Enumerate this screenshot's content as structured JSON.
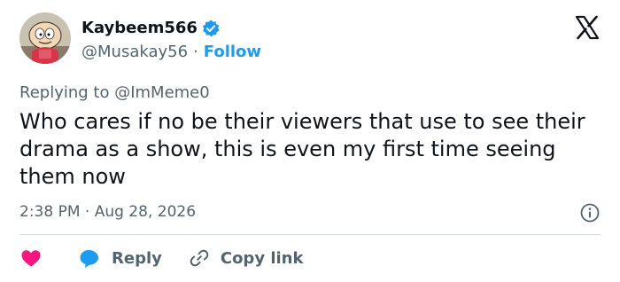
{
  "author": {
    "display_name": "Kaybeem566",
    "handle": "@Musakay56",
    "separator": "·",
    "follow_label": "Follow",
    "verified": true,
    "avatar_icon": "cartoon-character-avatar"
  },
  "reply_context": {
    "prefix": "Replying to ",
    "mention": "@ImMeme0"
  },
  "tweet": {
    "text": "Who cares if no be their viewers that use to see their drama as a show, this is even my first time seeing them now",
    "timestamp": "2:38 PM · Aug 28, 2026"
  },
  "actions": {
    "like_icon": "heart-icon",
    "reply_label": "Reply",
    "copy_link_label": "Copy link"
  },
  "colors": {
    "accent": "#1d9bf0",
    "like": "#f91880",
    "secondary_text": "#536471",
    "primary_text": "#0f1419",
    "divider": "#cfd9de"
  }
}
